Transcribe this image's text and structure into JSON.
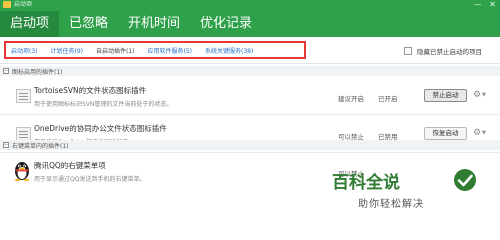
{
  "window": {
    "title": "启动项",
    "min": "—",
    "close": "✕"
  },
  "tabs": [
    {
      "label": "启动项",
      "active": true
    },
    {
      "label": "已忽略",
      "active": false
    },
    {
      "label": "开机时间",
      "active": false
    },
    {
      "label": "优化记录",
      "active": false
    }
  ],
  "subtabs": [
    {
      "label": "启动项(3)"
    },
    {
      "label": "计划任务(9)"
    },
    {
      "label": "自启动插件(1)"
    },
    {
      "label": "应用软件服务(5)"
    },
    {
      "label": "系统关键服务(38)"
    }
  ],
  "hide_option": {
    "label": "隐藏已禁止启动的项目",
    "checked": false
  },
  "sections": [
    {
      "title": "图标启用的插件(1)",
      "toggle": "−"
    },
    {
      "title": "右键菜单内的插件(1)",
      "toggle": "−"
    }
  ],
  "rows": [
    {
      "title": "TortoiseSVN的文件状态图标插件",
      "desc": "用于使用图标标识SVN管理的文件当前处于的状态。",
      "advice": "建议开启",
      "status": "已开启",
      "button": "禁止启动",
      "icon": "document-icon"
    },
    {
      "title": "OneDrive的协同办公文件状态图标插件",
      "desc": "用于显示OneDrive的文件同步状态。",
      "advice": "可以禁止",
      "status": "已禁用",
      "button": "恢复启动",
      "icon": "document-icon"
    },
    {
      "title": "腾讯QQ的右键菜单项",
      "desc": "用于显示通过QQ发送到手机的右键菜单。",
      "advice": "可以禁止",
      "status": "",
      "button": "",
      "icon": "qq-penguin-icon"
    }
  ],
  "watermark": {
    "logo": "百科全说",
    "tagline": "助你轻松解决"
  },
  "colors": {
    "header": "#2fa14a",
    "active_tab": "#258a3d",
    "highlight_border": "#e53935",
    "link": "#2a72c9"
  }
}
